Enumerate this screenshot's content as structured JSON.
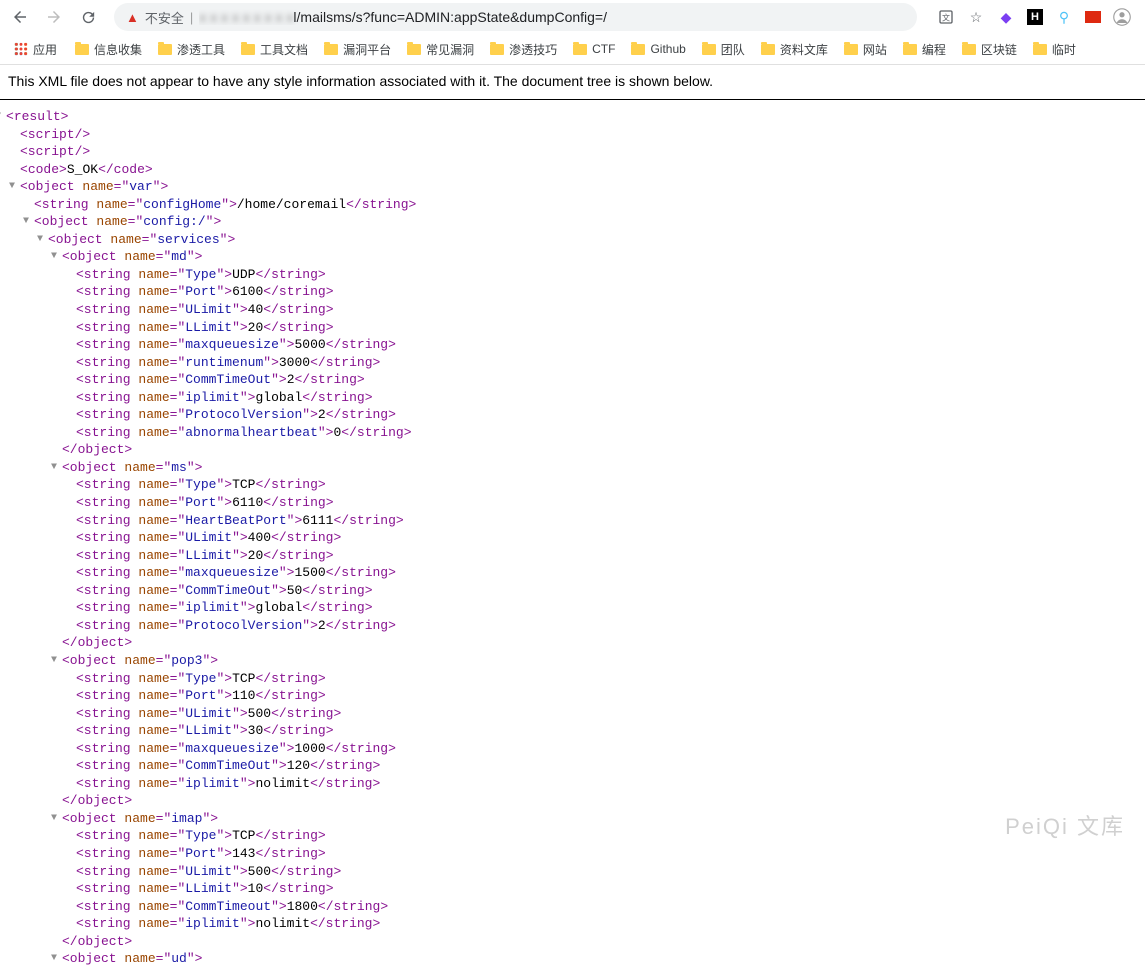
{
  "browser": {
    "security_warning": "不安全",
    "url_prefix_hidden": "x x x x x x x x x",
    "url_visible": "l/mailsms/s?func=ADMIN:appState&dumpConfig=/",
    "apps_label": "应用",
    "bookmarks": [
      "信息收集",
      "渗透工具",
      "工具文档",
      "漏洞平台",
      "常见漏洞",
      "渗透技巧",
      "CTF",
      "Github",
      "团队",
      "资料文库",
      "网站",
      "编程",
      "区块链",
      "临时"
    ]
  },
  "xml": {
    "notice": "This XML file does not appear to have any style information associated with it. The document tree is shown below.",
    "root_tag": "result",
    "code_tag": "code",
    "code_value": "S_OK",
    "var_name": "var",
    "configHome_name": "configHome",
    "configHome_value": "/home/coremail",
    "config_name": "config:/",
    "services_name": "services",
    "services": [
      {
        "name": "md",
        "props": [
          {
            "name": "Type",
            "value": "UDP"
          },
          {
            "name": "Port",
            "value": "6100"
          },
          {
            "name": "ULimit",
            "value": "40"
          },
          {
            "name": "LLimit",
            "value": "20"
          },
          {
            "name": "maxqueuesize",
            "value": "5000"
          },
          {
            "name": "runtimenum",
            "value": "3000"
          },
          {
            "name": "CommTimeOut",
            "value": "2"
          },
          {
            "name": "iplimit",
            "value": "global"
          },
          {
            "name": "ProtocolVersion",
            "value": "2"
          },
          {
            "name": "abnormalheartbeat",
            "value": "0"
          }
        ]
      },
      {
        "name": "ms",
        "props": [
          {
            "name": "Type",
            "value": "TCP"
          },
          {
            "name": "Port",
            "value": "6110"
          },
          {
            "name": "HeartBeatPort",
            "value": "6111"
          },
          {
            "name": "ULimit",
            "value": "400"
          },
          {
            "name": "LLimit",
            "value": "20"
          },
          {
            "name": "maxqueuesize",
            "value": "1500"
          },
          {
            "name": "CommTimeOut",
            "value": "50"
          },
          {
            "name": "iplimit",
            "value": "global"
          },
          {
            "name": "ProtocolVersion",
            "value": "2"
          }
        ]
      },
      {
        "name": "pop3",
        "props": [
          {
            "name": "Type",
            "value": "TCP"
          },
          {
            "name": "Port",
            "value": "110"
          },
          {
            "name": "ULimit",
            "value": "500"
          },
          {
            "name": "LLimit",
            "value": "30"
          },
          {
            "name": "maxqueuesize",
            "value": "1000"
          },
          {
            "name": "CommTimeOut",
            "value": "120"
          },
          {
            "name": "iplimit",
            "value": "nolimit"
          }
        ]
      },
      {
        "name": "imap",
        "props": [
          {
            "name": "Type",
            "value": "TCP"
          },
          {
            "name": "Port",
            "value": "143"
          },
          {
            "name": "ULimit",
            "value": "500"
          },
          {
            "name": "LLimit",
            "value": "10"
          },
          {
            "name": "CommTimeout",
            "value": "1800"
          },
          {
            "name": "iplimit",
            "value": "nolimit"
          }
        ]
      }
    ],
    "trailing_object_name": "ud"
  },
  "watermark": "PeiQi 文库"
}
